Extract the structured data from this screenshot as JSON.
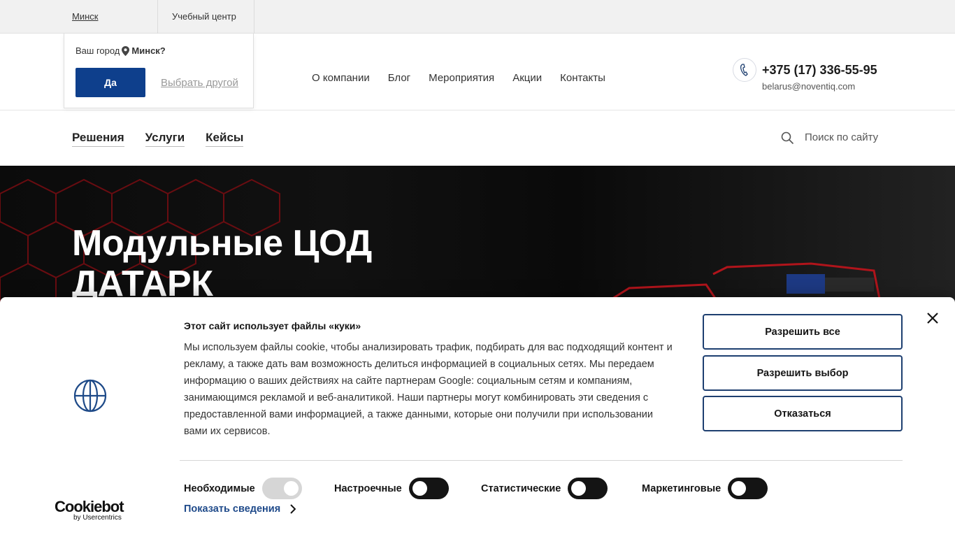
{
  "topbar": {
    "city": "Минск",
    "education": "Учебный центр"
  },
  "city_popup": {
    "question": "Ваш город",
    "city": "Минск?",
    "yes_label": "Да",
    "choose_other": "Выбрать другой"
  },
  "header": {
    "nav": [
      "О компании",
      "Блог",
      "Мероприятия",
      "Акции",
      "Контакты"
    ],
    "phone": "+375 (17) 336-55-95",
    "email": "belarus@noventiq.com"
  },
  "subnav": {
    "items": [
      "Решения",
      "Услуги",
      "Кейсы"
    ],
    "search_placeholder": "Поиск по сайту"
  },
  "hero": {
    "title_line1": "Модульные ЦОД",
    "title_line2": "ДАТАРК"
  },
  "cookie": {
    "title": "Этот сайт использует файлы «куки»",
    "text": "Мы используем файлы cookie, чтобы анализировать трафик, подбирать для вас подходящий контент и рекламу, а также дать вам возможность делиться информацией в социальных сетях. Мы передаем информацию о ваших действиях на сайте партнерам Google: социальным сетям и компаниям, занимающимся рекламой и веб-аналитикой. Наши партнеры могут комбинировать эти сведения с предоставленной вами информацией, а также данными, которые они получили при использовании вами их сервисов.",
    "allow_all": "Разрешить все",
    "allow_selection": "Разрешить выбор",
    "decline": "Отказаться",
    "toggles": [
      {
        "label": "Необходимые",
        "on": true
      },
      {
        "label": "Настроечные",
        "on": false
      },
      {
        "label": "Статистические",
        "on": false
      },
      {
        "label": "Маркетинговые",
        "on": false
      }
    ],
    "show_details": "Показать сведения",
    "brand": "Cookiebot",
    "brand_sub": "by Usercentrics"
  },
  "colors": {
    "primary_blue": "#0e3f8c",
    "button_border": "#1e3f70",
    "link_blue": "#1f4a8a"
  }
}
